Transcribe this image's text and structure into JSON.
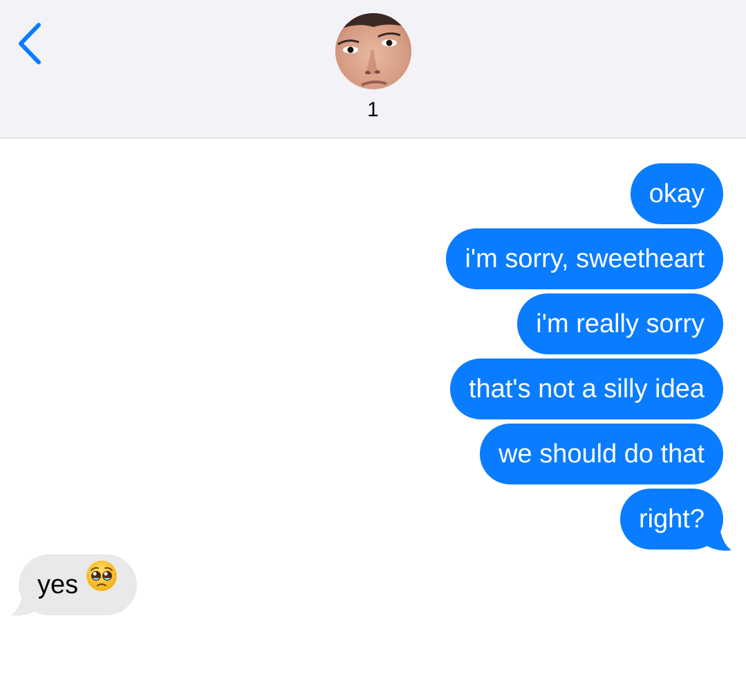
{
  "header": {
    "contact_name": "1",
    "back_icon": "chevron-left-icon",
    "avatar": "contact-avatar-photo"
  },
  "messages": [
    {
      "direction": "outgoing",
      "text": "okay"
    },
    {
      "direction": "outgoing",
      "text": "i'm sorry, sweetheart"
    },
    {
      "direction": "outgoing",
      "text": "i'm really sorry"
    },
    {
      "direction": "outgoing",
      "text": "that's not a silly idea"
    },
    {
      "direction": "outgoing",
      "text": "we should do that"
    },
    {
      "direction": "outgoing",
      "text": "right?"
    },
    {
      "direction": "incoming",
      "text": "yes",
      "emoji": "pleading-face-emoji"
    }
  ],
  "colors": {
    "outgoing_bubble": "#0a7cff",
    "incoming_bubble": "#e9e9eb",
    "header_bg": "#f2f2f7",
    "accent": "#0a7cff"
  }
}
